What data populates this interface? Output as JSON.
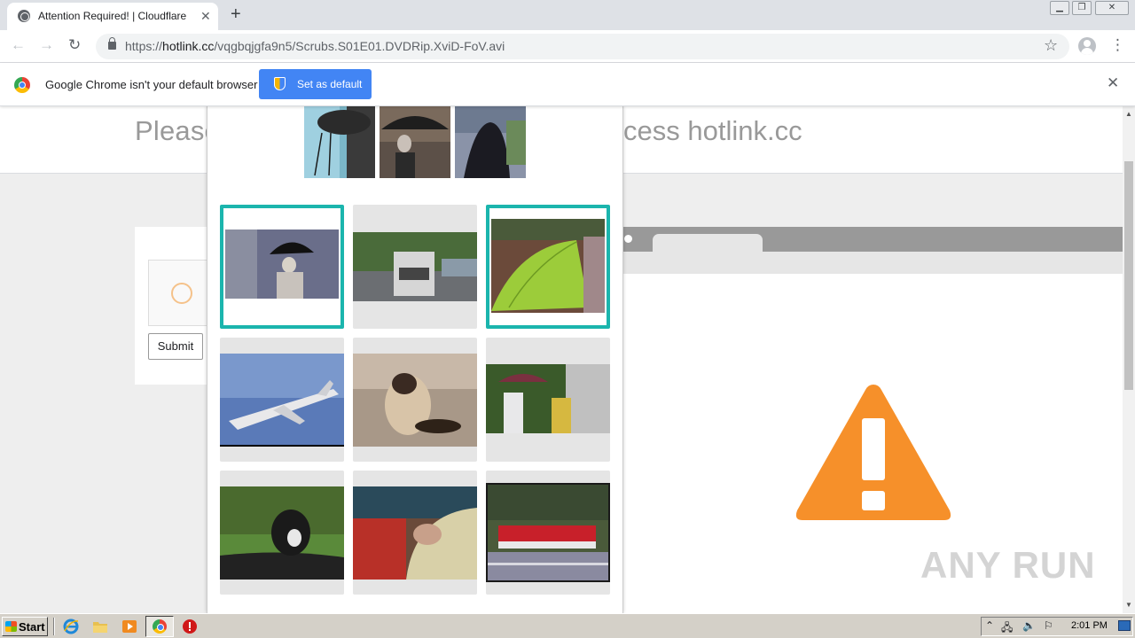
{
  "browser": {
    "tab_title": "Attention Required! | Cloudflare",
    "url_scheme": "https://",
    "url_host": "hotlink.cc",
    "url_path": "/vqgbqjgfa9n5/Scrubs.S01E01.DVDRip.XviD-FoV.avi"
  },
  "infobar": {
    "message": "Google Chrome isn't your default browser",
    "button_label": "Set as default"
  },
  "page": {
    "heading_left": "Please",
    "heading_right": "cess hotlink.cc",
    "submit_label": "Submit"
  },
  "captcha": {
    "sample_images": [
      "umbrella-person-1",
      "umbrella-person-2",
      "umbrella-person-3"
    ],
    "grid": [
      {
        "subject": "person with umbrella at fence",
        "selected": true
      },
      {
        "subject": "garbage truck on road",
        "selected": false
      },
      {
        "subject": "green umbrella",
        "selected": true
      },
      {
        "subject": "airliner in sky",
        "selected": false
      },
      {
        "subject": "siamese cat",
        "selected": false
      },
      {
        "subject": "people with umbrella",
        "selected": false
      },
      {
        "subject": "dog in car",
        "selected": false
      },
      {
        "subject": "market umbrella",
        "selected": false
      },
      {
        "subject": "red train",
        "selected": false
      }
    ]
  },
  "watermark": "ANY RUN",
  "taskbar": {
    "start_label": "Start",
    "clock": "2:01 PM"
  },
  "colors": {
    "accent_blue": "#4285f4",
    "captcha_selected": "#1bb5ad",
    "warning_orange": "#f6902a"
  }
}
